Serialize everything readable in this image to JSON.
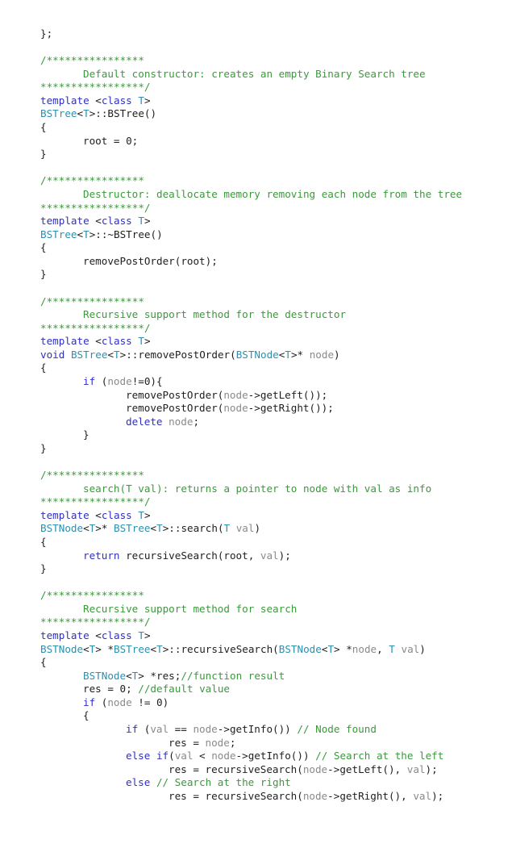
{
  "colors": {
    "keyword": "#3030c0",
    "type": "#2b91af",
    "comment": "#3a9a3a",
    "parameter": "#8a8a8a",
    "text": "#1e1e1e",
    "background": "#ffffff"
  },
  "lines": [
    {
      "indent": 0,
      "tokens": [
        {
          "t": "tx",
          "v": "};"
        }
      ]
    },
    {
      "indent": 0,
      "tokens": []
    },
    {
      "indent": 0,
      "tokens": [
        {
          "t": "cm",
          "v": "/****************"
        }
      ]
    },
    {
      "indent": 1,
      "tokens": [
        {
          "t": "cm",
          "v": "Default constructor: creates an empty Binary Search tree"
        }
      ]
    },
    {
      "indent": 0,
      "tokens": [
        {
          "t": "cm",
          "v": "*****************/"
        }
      ]
    },
    {
      "indent": 0,
      "tokens": [
        {
          "t": "kw",
          "v": "template"
        },
        {
          "t": "tx",
          "v": " <"
        },
        {
          "t": "kw",
          "v": "class"
        },
        {
          "t": "tx",
          "v": " "
        },
        {
          "t": "ty",
          "v": "T"
        },
        {
          "t": "tx",
          "v": ">"
        }
      ]
    },
    {
      "indent": 0,
      "tokens": [
        {
          "t": "ty",
          "v": "BSTree"
        },
        {
          "t": "tx",
          "v": "<"
        },
        {
          "t": "ty",
          "v": "T"
        },
        {
          "t": "tx",
          "v": ">::BSTree()"
        }
      ]
    },
    {
      "indent": 0,
      "tokens": [
        {
          "t": "tx",
          "v": "{"
        }
      ]
    },
    {
      "indent": 1,
      "tokens": [
        {
          "t": "tx",
          "v": "root = 0;"
        }
      ]
    },
    {
      "indent": 0,
      "tokens": [
        {
          "t": "tx",
          "v": "}"
        }
      ]
    },
    {
      "indent": 0,
      "tokens": []
    },
    {
      "indent": 0,
      "tokens": [
        {
          "t": "cm",
          "v": "/****************"
        }
      ]
    },
    {
      "indent": 1,
      "tokens": [
        {
          "t": "cm",
          "v": "Destructor: deallocate memory removing each node from the tree"
        }
      ]
    },
    {
      "indent": 0,
      "tokens": [
        {
          "t": "cm",
          "v": "*****************/"
        }
      ]
    },
    {
      "indent": 0,
      "tokens": [
        {
          "t": "kw",
          "v": "template"
        },
        {
          "t": "tx",
          "v": " <"
        },
        {
          "t": "kw",
          "v": "class"
        },
        {
          "t": "tx",
          "v": " "
        },
        {
          "t": "ty",
          "v": "T"
        },
        {
          "t": "tx",
          "v": ">"
        }
      ]
    },
    {
      "indent": 0,
      "tokens": [
        {
          "t": "ty",
          "v": "BSTree"
        },
        {
          "t": "tx",
          "v": "<"
        },
        {
          "t": "ty",
          "v": "T"
        },
        {
          "t": "tx",
          "v": ">::~BSTree()"
        }
      ]
    },
    {
      "indent": 0,
      "tokens": [
        {
          "t": "tx",
          "v": "{"
        }
      ]
    },
    {
      "indent": 1,
      "tokens": [
        {
          "t": "tx",
          "v": "removePostOrder(root);"
        }
      ]
    },
    {
      "indent": 0,
      "tokens": [
        {
          "t": "tx",
          "v": "}"
        }
      ]
    },
    {
      "indent": 0,
      "tokens": []
    },
    {
      "indent": 0,
      "tokens": [
        {
          "t": "cm",
          "v": "/****************"
        }
      ]
    },
    {
      "indent": 1,
      "tokens": [
        {
          "t": "cm",
          "v": "Recursive support method for the destructor"
        }
      ]
    },
    {
      "indent": 0,
      "tokens": [
        {
          "t": "cm",
          "v": "*****************/"
        }
      ]
    },
    {
      "indent": 0,
      "tokens": [
        {
          "t": "kw",
          "v": "template"
        },
        {
          "t": "tx",
          "v": " <"
        },
        {
          "t": "kw",
          "v": "class"
        },
        {
          "t": "tx",
          "v": " "
        },
        {
          "t": "ty",
          "v": "T"
        },
        {
          "t": "tx",
          "v": ">"
        }
      ]
    },
    {
      "indent": 0,
      "tokens": [
        {
          "t": "kw",
          "v": "void"
        },
        {
          "t": "tx",
          "v": " "
        },
        {
          "t": "ty",
          "v": "BSTree"
        },
        {
          "t": "tx",
          "v": "<"
        },
        {
          "t": "ty",
          "v": "T"
        },
        {
          "t": "tx",
          "v": ">::removePostOrder("
        },
        {
          "t": "ty",
          "v": "BSTNode"
        },
        {
          "t": "tx",
          "v": "<"
        },
        {
          "t": "ty",
          "v": "T"
        },
        {
          "t": "tx",
          "v": ">* "
        },
        {
          "t": "pm",
          "v": "node"
        },
        {
          "t": "tx",
          "v": ")"
        }
      ]
    },
    {
      "indent": 0,
      "tokens": [
        {
          "t": "tx",
          "v": "{"
        }
      ]
    },
    {
      "indent": 1,
      "tokens": [
        {
          "t": "kw",
          "v": "if"
        },
        {
          "t": "tx",
          "v": " ("
        },
        {
          "t": "pm",
          "v": "node"
        },
        {
          "t": "tx",
          "v": "!=0){"
        }
      ]
    },
    {
      "indent": 2,
      "tokens": [
        {
          "t": "tx",
          "v": "removePostOrder("
        },
        {
          "t": "pm",
          "v": "node"
        },
        {
          "t": "tx",
          "v": "->getLeft());"
        }
      ]
    },
    {
      "indent": 2,
      "tokens": [
        {
          "t": "tx",
          "v": "removePostOrder("
        },
        {
          "t": "pm",
          "v": "node"
        },
        {
          "t": "tx",
          "v": "->getRight());"
        }
      ]
    },
    {
      "indent": 2,
      "tokens": [
        {
          "t": "kw",
          "v": "delete"
        },
        {
          "t": "tx",
          "v": " "
        },
        {
          "t": "pm",
          "v": "node"
        },
        {
          "t": "tx",
          "v": ";"
        }
      ]
    },
    {
      "indent": 1,
      "tokens": [
        {
          "t": "tx",
          "v": "}"
        }
      ]
    },
    {
      "indent": 0,
      "tokens": [
        {
          "t": "tx",
          "v": "}"
        }
      ]
    },
    {
      "indent": 0,
      "tokens": []
    },
    {
      "indent": 0,
      "tokens": [
        {
          "t": "cm",
          "v": "/****************"
        }
      ]
    },
    {
      "indent": 1,
      "tokens": [
        {
          "t": "cm",
          "v": "search(T val): returns a pointer to node with val as info"
        }
      ]
    },
    {
      "indent": 0,
      "tokens": [
        {
          "t": "cm",
          "v": "*****************/"
        }
      ]
    },
    {
      "indent": 0,
      "tokens": [
        {
          "t": "kw",
          "v": "template"
        },
        {
          "t": "tx",
          "v": " <"
        },
        {
          "t": "kw",
          "v": "class"
        },
        {
          "t": "tx",
          "v": " "
        },
        {
          "t": "ty",
          "v": "T"
        },
        {
          "t": "tx",
          "v": ">"
        }
      ]
    },
    {
      "indent": 0,
      "tokens": [
        {
          "t": "ty",
          "v": "BSTNode"
        },
        {
          "t": "tx",
          "v": "<"
        },
        {
          "t": "ty",
          "v": "T"
        },
        {
          "t": "tx",
          "v": ">* "
        },
        {
          "t": "ty",
          "v": "BSTree"
        },
        {
          "t": "tx",
          "v": "<"
        },
        {
          "t": "ty",
          "v": "T"
        },
        {
          "t": "tx",
          "v": ">::search("
        },
        {
          "t": "ty",
          "v": "T"
        },
        {
          "t": "tx",
          "v": " "
        },
        {
          "t": "pm",
          "v": "val"
        },
        {
          "t": "tx",
          "v": ")"
        }
      ]
    },
    {
      "indent": 0,
      "tokens": [
        {
          "t": "tx",
          "v": "{"
        }
      ]
    },
    {
      "indent": 1,
      "tokens": [
        {
          "t": "kw",
          "v": "return"
        },
        {
          "t": "tx",
          "v": " recursiveSearch(root, "
        },
        {
          "t": "pm",
          "v": "val"
        },
        {
          "t": "tx",
          "v": ");"
        }
      ]
    },
    {
      "indent": 0,
      "tokens": [
        {
          "t": "tx",
          "v": "}"
        }
      ]
    },
    {
      "indent": 0,
      "tokens": []
    },
    {
      "indent": 0,
      "tokens": [
        {
          "t": "cm",
          "v": "/****************"
        }
      ]
    },
    {
      "indent": 1,
      "tokens": [
        {
          "t": "cm",
          "v": "Recursive support method for search"
        }
      ]
    },
    {
      "indent": 0,
      "tokens": [
        {
          "t": "cm",
          "v": "*****************/"
        }
      ]
    },
    {
      "indent": 0,
      "tokens": [
        {
          "t": "kw",
          "v": "template"
        },
        {
          "t": "tx",
          "v": " <"
        },
        {
          "t": "kw",
          "v": "class"
        },
        {
          "t": "tx",
          "v": " "
        },
        {
          "t": "ty",
          "v": "T"
        },
        {
          "t": "tx",
          "v": ">"
        }
      ]
    },
    {
      "indent": 0,
      "tokens": [
        {
          "t": "ty",
          "v": "BSTNode"
        },
        {
          "t": "tx",
          "v": "<"
        },
        {
          "t": "ty",
          "v": "T"
        },
        {
          "t": "tx",
          "v": "> *"
        },
        {
          "t": "ty",
          "v": "BSTree"
        },
        {
          "t": "tx",
          "v": "<"
        },
        {
          "t": "ty",
          "v": "T"
        },
        {
          "t": "tx",
          "v": ">::recursiveSearch("
        },
        {
          "t": "ty",
          "v": "BSTNode"
        },
        {
          "t": "tx",
          "v": "<"
        },
        {
          "t": "ty",
          "v": "T"
        },
        {
          "t": "tx",
          "v": "> *"
        },
        {
          "t": "pm",
          "v": "node"
        },
        {
          "t": "tx",
          "v": ", "
        },
        {
          "t": "ty",
          "v": "T"
        },
        {
          "t": "tx",
          "v": " "
        },
        {
          "t": "pm",
          "v": "val"
        },
        {
          "t": "tx",
          "v": ")"
        }
      ]
    },
    {
      "indent": 0,
      "tokens": [
        {
          "t": "tx",
          "v": "{"
        }
      ]
    },
    {
      "indent": 1,
      "tokens": [
        {
          "t": "ty",
          "v": "BSTNode"
        },
        {
          "t": "tx",
          "v": "<"
        },
        {
          "t": "ty",
          "v": "T"
        },
        {
          "t": "tx",
          "v": "> *res;"
        },
        {
          "t": "cm",
          "v": "//function result"
        }
      ]
    },
    {
      "indent": 1,
      "tokens": [
        {
          "t": "tx",
          "v": "res = 0; "
        },
        {
          "t": "cm",
          "v": "//default value"
        }
      ]
    },
    {
      "indent": 1,
      "tokens": [
        {
          "t": "kw",
          "v": "if"
        },
        {
          "t": "tx",
          "v": " ("
        },
        {
          "t": "pm",
          "v": "node"
        },
        {
          "t": "tx",
          "v": " != 0)"
        }
      ]
    },
    {
      "indent": 1,
      "tokens": [
        {
          "t": "tx",
          "v": "{"
        }
      ]
    },
    {
      "indent": 2,
      "tokens": [
        {
          "t": "kw",
          "v": "if"
        },
        {
          "t": "tx",
          "v": " ("
        },
        {
          "t": "pm",
          "v": "val"
        },
        {
          "t": "tx",
          "v": " == "
        },
        {
          "t": "pm",
          "v": "node"
        },
        {
          "t": "tx",
          "v": "->getInfo()) "
        },
        {
          "t": "cm",
          "v": "// Node found"
        }
      ]
    },
    {
      "indent": 3,
      "tokens": [
        {
          "t": "tx",
          "v": "res = "
        },
        {
          "t": "pm",
          "v": "node"
        },
        {
          "t": "tx",
          "v": ";"
        }
      ]
    },
    {
      "indent": 2,
      "tokens": [
        {
          "t": "kw",
          "v": "else"
        },
        {
          "t": "tx",
          "v": " "
        },
        {
          "t": "kw",
          "v": "if"
        },
        {
          "t": "tx",
          "v": "("
        },
        {
          "t": "pm",
          "v": "val"
        },
        {
          "t": "tx",
          "v": " < "
        },
        {
          "t": "pm",
          "v": "node"
        },
        {
          "t": "tx",
          "v": "->getInfo()) "
        },
        {
          "t": "cm",
          "v": "// Search at the left"
        }
      ]
    },
    {
      "indent": 3,
      "tokens": [
        {
          "t": "tx",
          "v": "res = recursiveSearch("
        },
        {
          "t": "pm",
          "v": "node"
        },
        {
          "t": "tx",
          "v": "->getLeft(), "
        },
        {
          "t": "pm",
          "v": "val"
        },
        {
          "t": "tx",
          "v": ");"
        }
      ]
    },
    {
      "indent": 2,
      "tokens": [
        {
          "t": "kw",
          "v": "else"
        },
        {
          "t": "tx",
          "v": " "
        },
        {
          "t": "cm",
          "v": "// Search at the right"
        }
      ]
    },
    {
      "indent": 3,
      "tokens": [
        {
          "t": "tx",
          "v": "res = recursiveSearch("
        },
        {
          "t": "pm",
          "v": "node"
        },
        {
          "t": "tx",
          "v": "->getRight(), "
        },
        {
          "t": "pm",
          "v": "val"
        },
        {
          "t": "tx",
          "v": ");"
        }
      ]
    }
  ]
}
